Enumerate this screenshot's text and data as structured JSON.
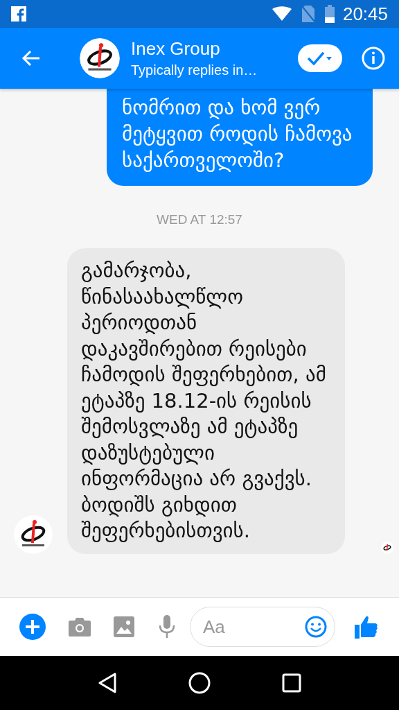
{
  "status_bar": {
    "time": "20:45"
  },
  "header": {
    "name": "Inex Group",
    "subtitle": "Typically replies in…"
  },
  "messages": [
    {
      "kind": "outgoing",
      "text": "ნომრით და ხომ ვერ მეტყვით როდის ჩამოვა საქართველოში?"
    },
    {
      "kind": "timestamp",
      "text": "WED AT 12:57"
    },
    {
      "kind": "incoming",
      "text": "გამარჯობა, წინასაახალწლო პერიოდთან დაკავშირებით რეისები ჩამოდის შეფერხებით, ამ ეტაპზე 18.12-ის რეისის შემოსვლაზე ამ ეტაპზე დაზუსტებული ინფორმაცია არ გვაქვს. ბოდიშს გიხდით შეფერხებისთვის."
    }
  ],
  "composer": {
    "placeholder": "Aa"
  }
}
